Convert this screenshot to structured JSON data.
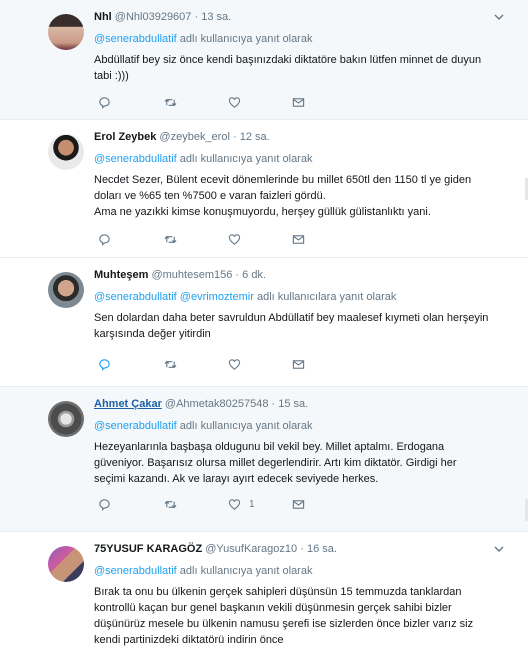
{
  "tweets": [
    {
      "name": "Nhl",
      "handle": "@Nhl03929607",
      "dot": "·",
      "time": "13 sa.",
      "reply_mentions": [
        "@senerabdullatif"
      ],
      "reply_suffix": "adlı kullanıcıya yanıt olarak",
      "body": [
        "Abdüllatif bey siz önce kendi başınızdaki diktatöre bakın lütfen minnet de duyun",
        "tabi :)))"
      ],
      "like_count": ""
    },
    {
      "name": "Erol Zeybek",
      "handle": "@zeybek_erol",
      "dot": "·",
      "time": "12 sa.",
      "reply_mentions": [
        "@senerabdullatif"
      ],
      "reply_suffix": "adlı kullanıcıya yanıt olarak",
      "body": [
        "Necdet Sezer, Bülent ecevit dönemlerinde bu millet 650tl den 1150 tl ye giden",
        "doları ve %65 ten %7500 e varan faizleri gördü.",
        "Ama ne yazıkki kimse konuşmuyordu, herşey güllük gülistanlıktı yani."
      ],
      "like_count": ""
    },
    {
      "name": "Muhteşem",
      "handle": "@muhtesem156",
      "dot": "·",
      "time": "6 dk.",
      "reply_mentions": [
        "@senerabdullatif",
        "@evrimoztemir"
      ],
      "reply_suffix": "adlı kullanıcılara yanıt olarak",
      "body": [
        "Sen dolardan daha beter savruldun Abdüllatif bey maalesef kıymeti olan herşeyin",
        "karşısında değer yitirdin"
      ],
      "like_count": ""
    },
    {
      "name": "Ahmet Çakar",
      "handle": "@Ahmetak80257548",
      "dot": "·",
      "time": "15 sa.",
      "reply_mentions": [
        "@senerabdullatif"
      ],
      "reply_suffix": "adlı kullanıcıya yanıt olarak",
      "body": [
        "Hezeyanlarınla başbaşa oldugunu bil vekil bey. Millet aptalmı. Erdogana",
        "güveniyor. Başarısız olursa millet degerlendirir. Artı kim diktatör. Girdigi her",
        "seçimi kazandı. Ak ve larayı ayırt edecek seviyede herkes."
      ],
      "like_count": "1"
    },
    {
      "name": "75YUSUF KARAGÖZ",
      "handle": "@YusufKaragoz10",
      "dot": "·",
      "time": "16 sa.",
      "reply_mentions": [
        "@senerabdullatif"
      ],
      "reply_suffix": "adlı kullanıcıya yanıt olarak",
      "body": [
        "Bırak ta  onu bu ülkenin gerçek sahipleri düşünsün 15 temmuzda tanklardan",
        "kontrollü kaçan bur genel başkanın vekili düşünmesin gerçek sahibi bizler",
        "düşünürüz mesele bu ülkenin namusu şerefi ise sizlerden önce bizler varız siz",
        "kendi partinizdeki diktatörü indirin önce"
      ],
      "like_count": ""
    }
  ],
  "colors": {
    "link": "#1da1f2",
    "muted": "#657786",
    "highlight_bg": "#f5f8fa",
    "divider": "#e6ecf0"
  }
}
